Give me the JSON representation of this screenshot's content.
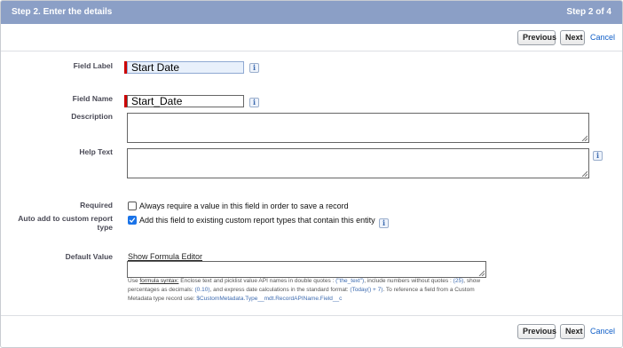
{
  "header": {
    "title": "Step 2. Enter the details",
    "step": "Step 2 of 4"
  },
  "nav": {
    "previous": "Previous",
    "next": "Next",
    "cancel": "Cancel"
  },
  "fields": {
    "field_label": {
      "label": "Field Label",
      "value": "Start Date"
    },
    "field_name": {
      "label": "Field Name",
      "value": "Start_Date"
    },
    "description": {
      "label": "Description",
      "value": ""
    },
    "help_text": {
      "label": "Help Text",
      "value": ""
    },
    "required": {
      "label": "Required",
      "text": "Always require a value in this field in order to save a record",
      "checked": false
    },
    "auto_add": {
      "label_line1": "Auto add to custom report",
      "label_line2": "type",
      "text": "Add this field to existing custom report types that contain this entity",
      "checked": true
    },
    "default_value": {
      "label": "Default Value",
      "link": "Show Formula Editor",
      "value": ""
    }
  },
  "info_icon": "i",
  "help": {
    "p1": "Use ",
    "formula_syntax": "formula syntax:",
    "p2": " Enclose text and picklist value API names in double quotes : ",
    "ex1": "(\"the_text\")",
    "p3": ", include numbers without quotes : ",
    "ex2": "(25)",
    "p4": ", show percentages as decimals: ",
    "ex3": "(0.10)",
    "p5": ", and express date calculations in the standard format: ",
    "ex4": "(Today() + 7)",
    "p6": ". To reference a field from a Custom Metadata type record use: ",
    "ex5": "$CustomMetadata.Type__mdt.RecordAPIName.Field__c"
  },
  "colors": {
    "header_bg": "#8b9fc6",
    "required_marker": "#cc0000",
    "link": "#0f5ec8",
    "checkbox_checked": "#1a73e8"
  }
}
